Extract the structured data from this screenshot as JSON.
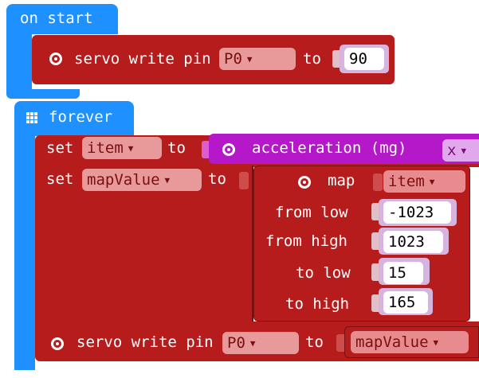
{
  "on_start": {
    "label": "on start",
    "servo_block": {
      "text": "servo write pin",
      "pin": "P0",
      "to_label": "to",
      "value": "90"
    }
  },
  "forever": {
    "label": "forever",
    "set_item": {
      "set_label": "set",
      "variable": "item",
      "to_label": "to",
      "acceleration_label": "acceleration (mg)",
      "axis": "x"
    },
    "set_mapvalue": {
      "set_label": "set",
      "variable": "mapValue",
      "to_label": "to",
      "map_label": "map",
      "map_input": "item",
      "from_low_label": "from low",
      "from_low": "-1023",
      "from_high_label": "from high",
      "from_high": "1023",
      "to_low_label": "to low",
      "to_low": "15",
      "to_high_label": "to high",
      "to_high": "165"
    },
    "servo_block": {
      "text": "servo write pin",
      "pin": "P0",
      "to_label": "to",
      "value_variable": "mapValue"
    }
  },
  "dropdown_arrow": "▼",
  "colors": {
    "events_blue": "#1e90ff",
    "pins_red": "#b71c1c",
    "input_purple": "#b418c8",
    "dropdown_pink": "#e8999a"
  }
}
